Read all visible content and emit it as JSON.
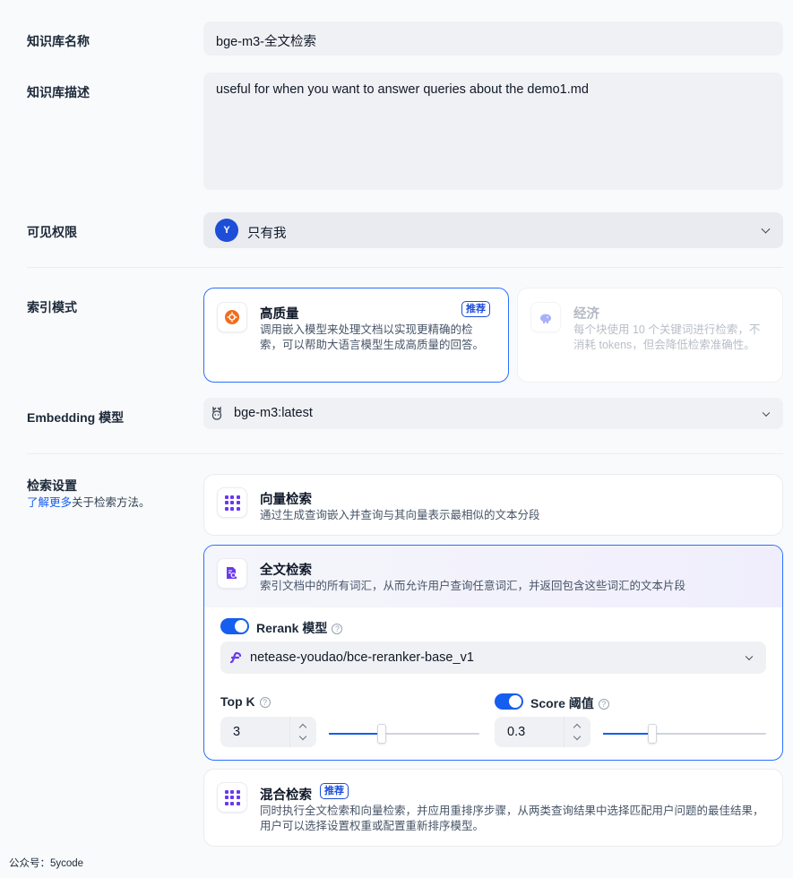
{
  "form": {
    "name_label": "知识库名称",
    "name_value": "bge-m3-全文检索",
    "desc_label": "知识库描述",
    "desc_value": "useful for when you want to answer queries about the demo1.md",
    "perm_label": "可见权限",
    "perm_avatar": "Y",
    "perm_value": "只有我",
    "index_label": "索引模式",
    "embed_label": "Embedding 模型",
    "embed_value": "bge-m3:latest",
    "search_label": "检索设置",
    "learn_more": "了解更多",
    "learn_more_suffix": "关于检索方法。"
  },
  "index_modes": {
    "high": {
      "title": "高质量",
      "badge": "推荐",
      "desc": "调用嵌入模型来处理文档以实现更精确的检索，可以帮助大语言模型生成高质量的回答。"
    },
    "eco": {
      "title": "经济",
      "desc": "每个块使用 10 个关键词进行检索，不消耗 tokens，但会降低检索准确性。"
    }
  },
  "search": {
    "vector": {
      "title": "向量检索",
      "desc": "通过生成查询嵌入并查询与其向量表示最相似的文本分段"
    },
    "fulltext": {
      "title": "全文检索",
      "desc": "索引文档中的所有词汇，从而允许用户查询任意词汇，并返回包含这些词汇的文本片段",
      "rerank_label": "Rerank 模型",
      "rerank_model": "netease-youdao/bce-reranker-base_v1",
      "topk_label": "Top K",
      "topk_value": "3",
      "topk_level": 0.35,
      "score_label": "Score 阈值",
      "score_value": "0.3",
      "score_level": 0.3
    },
    "hybrid": {
      "title": "混合检索",
      "badge": "推荐",
      "desc": "同时执行全文检索和向量检索，并应用重排序步骤，从两类查询结果中选择匹配用户问题的最佳结果，用户可以选择设置权重或配置重新排序模型。"
    }
  },
  "footer": "公众号：5ycode",
  "colors": {
    "primary": "#155eef",
    "avatar": "#1d4ed8",
    "accent_purple": "#6938ef",
    "orange": "#f26b1d"
  }
}
